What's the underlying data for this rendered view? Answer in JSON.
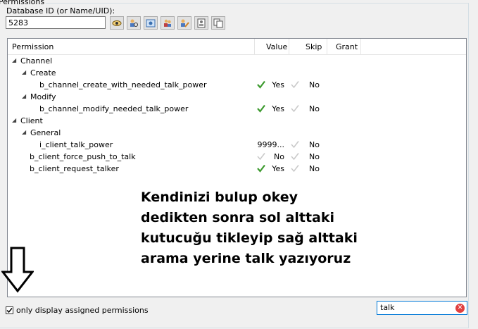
{
  "group": {
    "title": "Permissions"
  },
  "db": {
    "label": "Database ID (or Name/UID):",
    "value": "5283"
  },
  "toolbar": [
    {
      "name": "eye-icon"
    },
    {
      "name": "group-search-icon"
    },
    {
      "name": "id-card-icon"
    },
    {
      "name": "users-icon"
    },
    {
      "name": "edit-user-icon"
    },
    {
      "name": "contact-icon"
    },
    {
      "name": "copy-icon"
    }
  ],
  "tree": {
    "headers": {
      "permission": "Permission",
      "value": "Value",
      "skip": "Skip",
      "grant": "Grant"
    },
    "rows": [
      {
        "label": "Channel",
        "expander": "◢"
      },
      {
        "label": "Create",
        "expander": "◢"
      },
      {
        "label": "b_channel_create_with_needed_talk_power",
        "value": "Yes",
        "skip": "No",
        "checked": true
      },
      {
        "label": "Modify",
        "expander": "◢"
      },
      {
        "label": "b_channel_modify_needed_talk_power",
        "value": "Yes",
        "skip": "No",
        "checked": true
      },
      {
        "label": "Client",
        "expander": "◢"
      },
      {
        "label": "General",
        "expander": "◢"
      },
      {
        "label": "i_client_talk_power",
        "value": "9999...",
        "skip": "No"
      },
      {
        "label": "b_client_force_push_to_talk",
        "value": "No",
        "skip": "No",
        "checked": false
      },
      {
        "label": "b_client_request_talker",
        "value": "Yes",
        "skip": "No",
        "checked": true
      }
    ]
  },
  "annotation": {
    "line1": "Kendinizi bulup okey",
    "line2": "dedikten sonra sol alttaki",
    "line3": "kutucuğu tikleyip sağ alttaki",
    "line4": "arama yerine talk yazıyoruz"
  },
  "filter": {
    "label": "only display assigned permissions",
    "checked": true
  },
  "search": {
    "value": "talk"
  },
  "colors": {
    "check_green": "#3c9a2e",
    "clear_red": "#e04040",
    "focus_blue": "#0078d7"
  }
}
